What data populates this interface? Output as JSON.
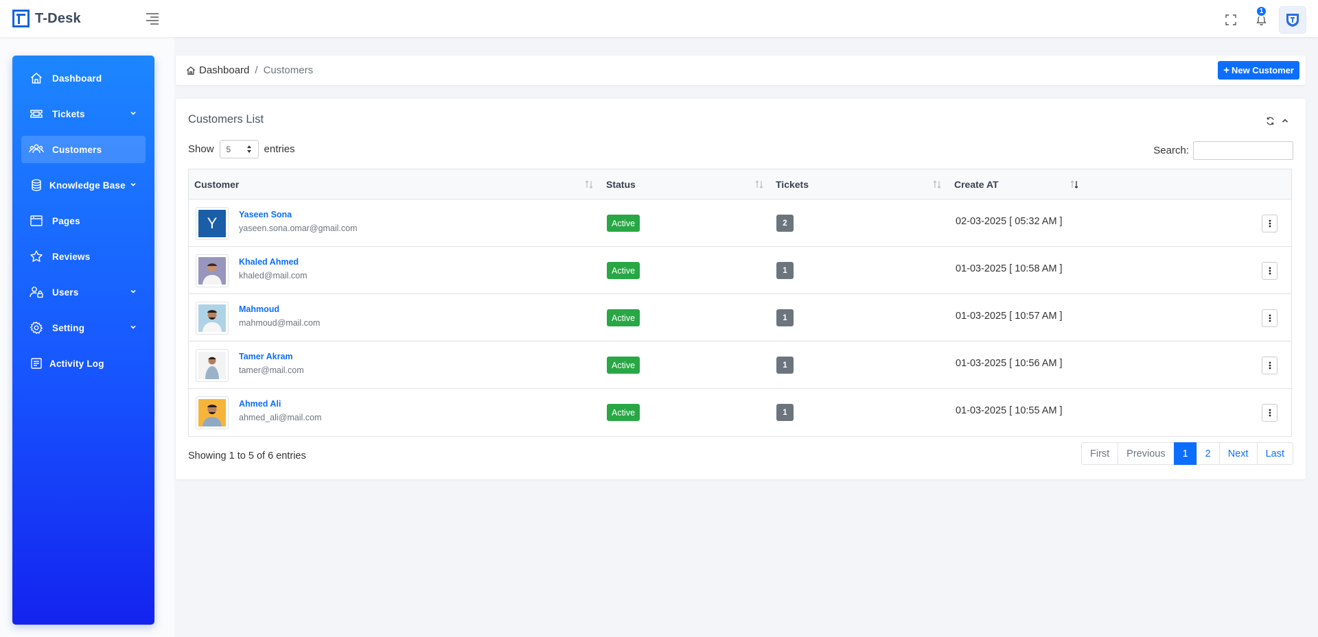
{
  "app": {
    "name": "T-Desk",
    "notification_count": "1"
  },
  "colors": {
    "primary": "#0d6efd",
    "sidebar_top": "#1d86ff",
    "sidebar_bottom": "#1423ef",
    "status_active": "#28a745",
    "ticket_badge": "#6c757d"
  },
  "sidebar": {
    "items": [
      {
        "label": "Dashboard",
        "icon": "home-icon",
        "has_submenu": false,
        "active": false
      },
      {
        "label": "Tickets",
        "icon": "ticket-icon",
        "has_submenu": true,
        "active": false
      },
      {
        "label": "Customers",
        "icon": "users-icon",
        "has_submenu": false,
        "active": true
      },
      {
        "label": "Knowledge Base",
        "icon": "database-icon",
        "has_submenu": true,
        "active": false
      },
      {
        "label": "Pages",
        "icon": "browser-window-icon",
        "has_submenu": false,
        "active": false
      },
      {
        "label": "Reviews",
        "icon": "star-icon",
        "has_submenu": false,
        "active": false
      },
      {
        "label": "Users",
        "icon": "user-lock-icon",
        "has_submenu": true,
        "active": false
      },
      {
        "label": "Setting",
        "icon": "gear-icon",
        "has_submenu": true,
        "active": false
      },
      {
        "label": "Activity Log",
        "icon": "log-icon",
        "has_submenu": false,
        "active": false
      }
    ]
  },
  "breadcrumb": {
    "home": "Dashboard",
    "separator": "/",
    "current": "Customers"
  },
  "actions": {
    "new_customer": "New Customer"
  },
  "card": {
    "title": "Customers List"
  },
  "table_controls": {
    "show_label": "Show",
    "entries_label": "entries",
    "page_length": "5",
    "search_label": "Search:",
    "search_value": ""
  },
  "table": {
    "columns": [
      "Customer",
      "Status",
      "Tickets",
      "Create AT"
    ],
    "rows": [
      {
        "name": "Yaseen Sona",
        "email": "yaseen.sona.omar@gmail.com",
        "status": "Active",
        "tickets": "2",
        "created": "02-03-2025 [ 05:32 AM ]",
        "avatar_letter": "Y"
      },
      {
        "name": "Khaled Ahmed",
        "email": "khaled@mail.com",
        "status": "Active",
        "tickets": "1",
        "created": "01-03-2025 [ 10:58 AM ]"
      },
      {
        "name": "Mahmoud",
        "email": "mahmoud@mail.com",
        "status": "Active",
        "tickets": "1",
        "created": "01-03-2025 [ 10:57 AM ]"
      },
      {
        "name": "Tamer Akram",
        "email": "tamer@mail.com",
        "status": "Active",
        "tickets": "1",
        "created": "01-03-2025 [ 10:56 AM ]"
      },
      {
        "name": "Ahmed Ali",
        "email": "ahmed_ali@mail.com",
        "status": "Active",
        "tickets": "1",
        "created": "01-03-2025 [ 10:55 AM ]"
      }
    ]
  },
  "table_info": "Showing 1 to 5 of 6 entries",
  "pagination": {
    "first": "First",
    "previous": "Previous",
    "pages": [
      "1",
      "2"
    ],
    "current_page": "1",
    "next": "Next",
    "last": "Last"
  }
}
